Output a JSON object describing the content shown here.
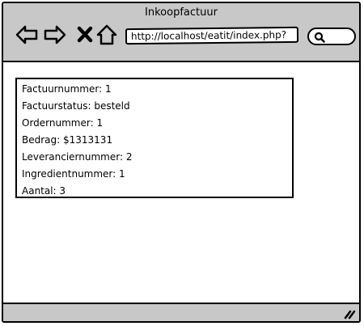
{
  "window": {
    "title": "Inkoopfactuur"
  },
  "toolbar": {
    "back_icon": "arrow-left-icon",
    "forward_icon": "arrow-right-icon",
    "close_icon": "close-icon",
    "home_icon": "home-icon",
    "url": "http://localhost/eatit/index.php?",
    "search_icon": "search-icon"
  },
  "invoice": {
    "lines": [
      "Factuurnummer: 1",
      "Factuurstatus: besteld",
      "Ordernummer: 1",
      "Bedrag: $1313131",
      "Leveranciernummer: 2",
      "Ingredientnummer: 1",
      "Aantal: 3"
    ]
  },
  "statusbar": {
    "grip_icon": "resize-grip-icon"
  },
  "colors": {
    "chrome": "#c8c8c8",
    "border": "#000000",
    "background": "#ffffff"
  }
}
